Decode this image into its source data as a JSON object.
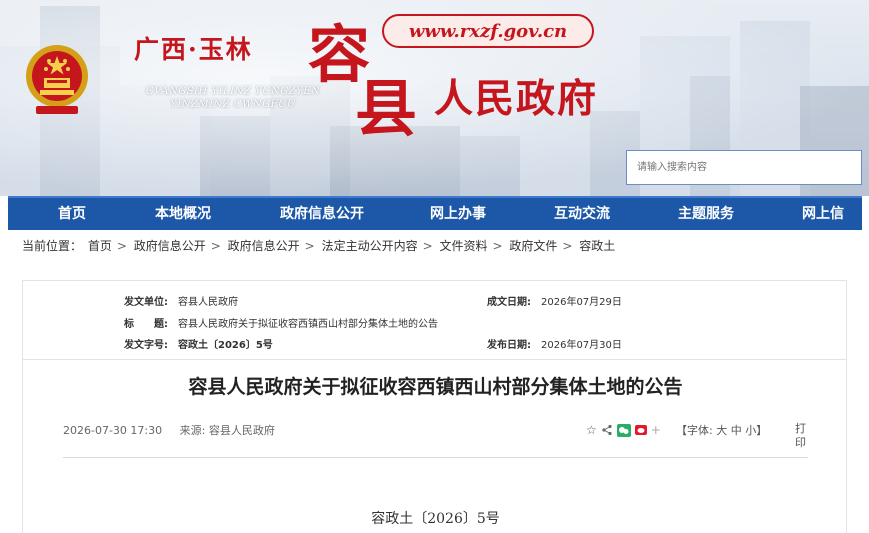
{
  "header": {
    "region": "广西·玉林",
    "pinyin_line1": "GVANGSIH YILINZ YUNGZYEN",
    "pinyin_line2": "YINZMINZ CWNGFUU",
    "big_char_1": "容",
    "big_char_2": "县",
    "gov_name": "人民政府",
    "url": "www.rxzf.gov.cn",
    "search_placeholder": "请输入搜索内容",
    "brand_red": "#c4161c"
  },
  "nav": {
    "items": [
      "首页",
      "本地概况",
      "政府信息公开",
      "网上办事",
      "互动交流",
      "主题服务",
      "网上信"
    ],
    "bg_color": "#1d58a8"
  },
  "breadcrumb": {
    "prefix": "当前位置：",
    "items": [
      "首页",
      "政府信息公开",
      "政府信息公开",
      "法定主动公开内容",
      "文件资料",
      "政府文件",
      "容政土"
    ],
    "separator": ">"
  },
  "info": {
    "issuer_label": "发文单位:",
    "issuer_value": "容县人民政府",
    "date_label": "成文日期:",
    "date_value": "2026年07月29日",
    "title_label": "标　　题:",
    "title_value": "容县人民政府关于拟征收容西镇西山村部分集体土地的公告",
    "docno_label": "发文字号:",
    "docno_value": "容政土〔2026〕5号",
    "publish_label": "发布日期:",
    "publish_value": "2026年07月30日"
  },
  "article": {
    "title": "容县人民政府关于拟征收容西镇西山村部分集体土地的公告",
    "datetime": "2026-07-30 17:30",
    "source_label": "来源:",
    "source_value": "容县人民政府",
    "fontsize_label": "【字体:",
    "fontsize_big": "大",
    "fontsize_mid": "中",
    "fontsize_small": "小】",
    "print_label": "打印",
    "doc_number": "容政土〔2026〕5号"
  }
}
